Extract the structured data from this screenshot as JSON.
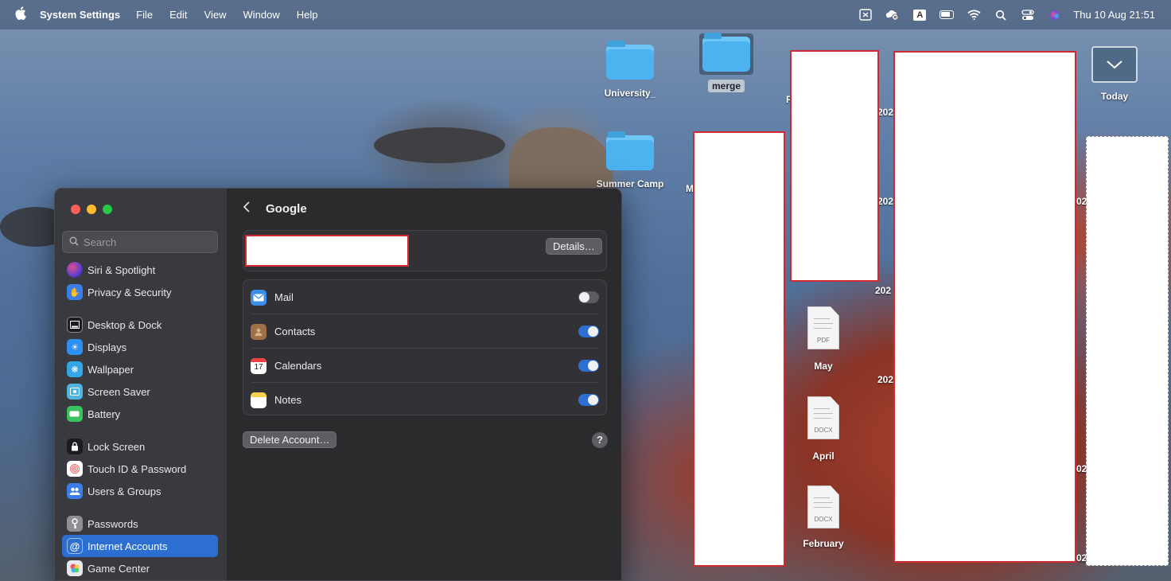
{
  "menubar": {
    "app_name": "System Settings",
    "menus": [
      "File",
      "Edit",
      "View",
      "Window",
      "Help"
    ],
    "input_source": "A",
    "clock": "Thu 10 Aug  21:51"
  },
  "desktop": {
    "folders": [
      {
        "label": "University_"
      },
      {
        "label": "merge"
      },
      {
        "label": "Summer Camp"
      }
    ],
    "documents": [
      {
        "label": "May",
        "tag": "PDF"
      },
      {
        "label": "April",
        "tag": "DOCX"
      },
      {
        "label": "February",
        "tag": "DOCX"
      }
    ],
    "stack_label": "Today",
    "fragments": {
      "year_prefix": "202",
      "year_tail": "02",
      "m": "M",
      "p": "P"
    }
  },
  "window": {
    "search_placeholder": "Search",
    "sidebar": [
      {
        "label": "Siri & Spotlight",
        "color": "#c0399a"
      },
      {
        "label": "Privacy & Security",
        "color": "#3b7ee8"
      },
      {
        "label": "Desktop & Dock",
        "color": "#1c1c1e"
      },
      {
        "label": "Displays",
        "color": "#2e8ff0"
      },
      {
        "label": "Wallpaper",
        "color": "#36a5e8"
      },
      {
        "label": "Screen Saver",
        "color": "#4fb4e0"
      },
      {
        "label": "Battery",
        "color": "#3cc25a"
      },
      {
        "label": "Lock Screen",
        "color": "#1c1c1e"
      },
      {
        "label": "Touch ID & Password",
        "color": "#f06a6a"
      },
      {
        "label": "Users & Groups",
        "color": "#3b7ee8"
      },
      {
        "label": "Passwords",
        "color": "#8e8e93"
      },
      {
        "label": "Internet Accounts",
        "color": "#2c6fd1"
      },
      {
        "label": "Game Center",
        "color": "#e8e8ea"
      }
    ],
    "active_item": "Internet Accounts",
    "content": {
      "title": "Google",
      "details_button": "Details…",
      "services": [
        {
          "label": "Mail",
          "enabled": false
        },
        {
          "label": "Contacts",
          "enabled": true
        },
        {
          "label": "Calendars",
          "enabled": true,
          "icon_text": "17"
        },
        {
          "label": "Notes",
          "enabled": true
        }
      ],
      "delete_button": "Delete Account…",
      "help": "?"
    }
  },
  "colors": {
    "accent": "#2c6fd1",
    "redaction_border": "#d02a30"
  }
}
